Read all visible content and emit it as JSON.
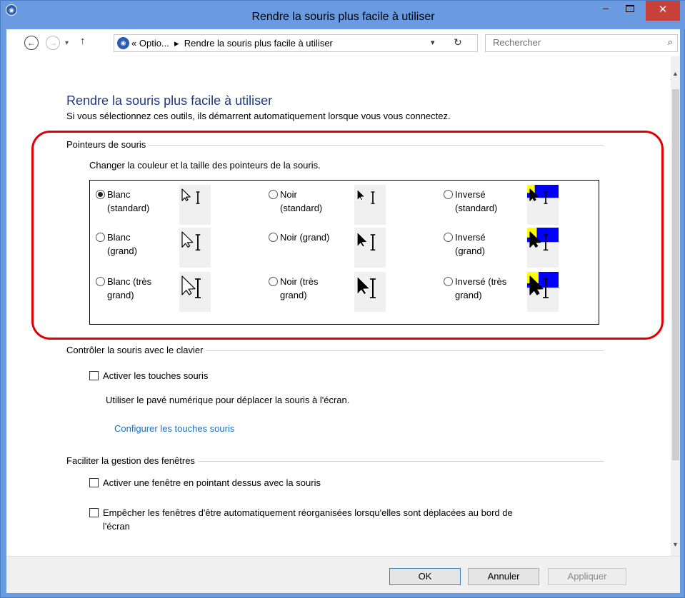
{
  "window": {
    "title": "Rendre la souris plus facile à utiliser",
    "app_icon": "ease-of-access-icon",
    "controls": {
      "minimize": "–",
      "maximize": "maximize-icon",
      "close": "✕"
    }
  },
  "address_bar": {
    "back": "←",
    "forward": "→",
    "dropdown": "▾",
    "up": "↑",
    "path_prefix": "«",
    "path_parent": "Optio...",
    "path_separator": "▸",
    "path_current": "Rendre la souris plus facile à utiliser",
    "drop_arrow": "▾",
    "refresh": "↻",
    "search_placeholder": "Rechercher",
    "search_icon": "⌕"
  },
  "page": {
    "heading": "Rendre la souris plus facile à utiliser",
    "subheading": "Si vous sélectionnez ces outils, ils démarrent automatiquement lorsque vous vous connectez."
  },
  "pointers": {
    "section_title": "Pointeurs de souris",
    "description": "Changer la couleur et la taille des pointeurs de la souris.",
    "highlight_color": "#e00000",
    "options": [
      {
        "line1": "Blanc",
        "line2": "(standard)",
        "selected": true,
        "scheme": "white",
        "size": "standard"
      },
      {
        "line1": "Noir",
        "line2": "(standard)",
        "selected": false,
        "scheme": "black",
        "size": "standard"
      },
      {
        "line1": "Inversé",
        "line2": "(standard)",
        "selected": false,
        "scheme": "inverted",
        "size": "standard"
      },
      {
        "line1": "Blanc",
        "line2": "(grand)",
        "selected": false,
        "scheme": "white",
        "size": "large"
      },
      {
        "line1": "Noir (grand)",
        "line2": "",
        "selected": false,
        "scheme": "black",
        "size": "large"
      },
      {
        "line1": "Inversé",
        "line2": "(grand)",
        "selected": false,
        "scheme": "inverted",
        "size": "large"
      },
      {
        "line1": "Blanc (très",
        "line2": "grand)",
        "selected": false,
        "scheme": "white",
        "size": "extra-large"
      },
      {
        "line1": "Noir (très",
        "line2": "grand)",
        "selected": false,
        "scheme": "black",
        "size": "extra-large"
      },
      {
        "line1": "Inversé (très",
        "line2": "grand)",
        "selected": false,
        "scheme": "inverted",
        "size": "extra-large"
      }
    ]
  },
  "keyboard": {
    "section_title": "Contrôler la souris avec le clavier",
    "checkbox_label": "Activer les touches souris",
    "checked": false,
    "description": "Utiliser le pavé numérique pour déplacer la souris à l'écran.",
    "link": "Configurer les touches souris"
  },
  "windows": {
    "section_title": "Faciliter la gestion des fenêtres",
    "option1": "Activer une fenêtre en pointant dessus avec la souris",
    "option1_checked": false,
    "option2_line1": "Empêcher les fenêtres d'être automatiquement réorganisées lorsqu'elles sont déplacées au bord de",
    "option2_line2": "l'écran",
    "option2_checked": false
  },
  "footer": {
    "ok": "OK",
    "cancel": "Annuler",
    "apply": "Appliquer"
  },
  "colors": {
    "title_bar": "#6a9be0",
    "close_button": "#c7403a",
    "heading": "#1e3a8a",
    "link": "#1a6fc2",
    "inverted_background": "#0000ff",
    "inverted_cursor": "#ffff00"
  }
}
